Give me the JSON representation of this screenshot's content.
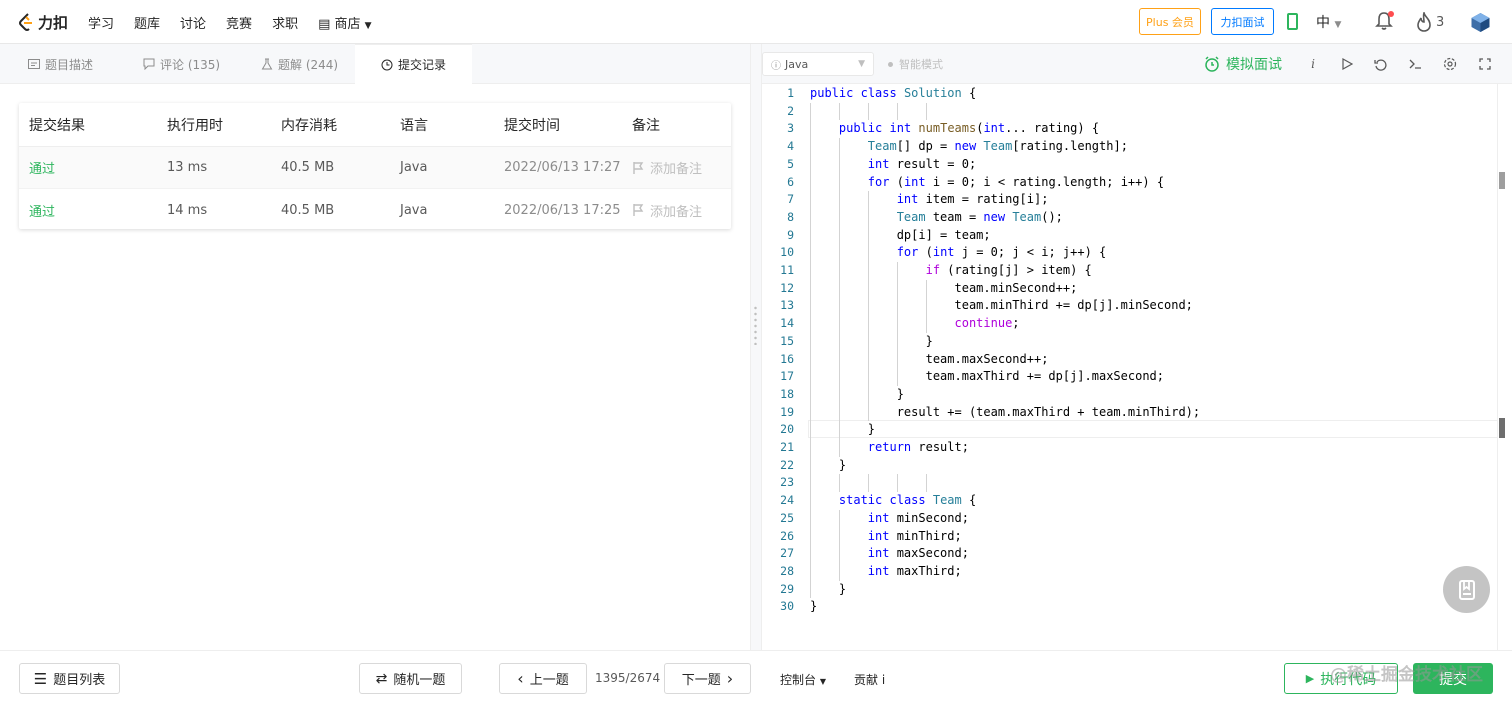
{
  "nav": {
    "logo_text": "力扣",
    "links": [
      "学习",
      "题库",
      "讨论",
      "竞赛",
      "求职"
    ],
    "store": "商店",
    "plus_label": "Plus 会员",
    "interview_label": "力扣面试",
    "lang": "中",
    "fire_count": "3"
  },
  "tabs": [
    {
      "label": "题目描述"
    },
    {
      "label": "评论 (135)"
    },
    {
      "label": "题解 (244)"
    },
    {
      "label": "提交记录"
    }
  ],
  "submissions": {
    "headers": [
      "提交结果",
      "执行用时",
      "内存消耗",
      "语言",
      "提交时间",
      "备注"
    ],
    "rows": [
      {
        "result": "通过",
        "runtime": "13 ms",
        "memory": "40.5 MB",
        "lang": "Java",
        "time": "2022/06/13 17:27",
        "note": "添加备注"
      },
      {
        "result": "通过",
        "runtime": "14 ms",
        "memory": "40.5 MB",
        "lang": "Java",
        "time": "2022/06/13 17:25",
        "note": "添加备注"
      }
    ]
  },
  "bottom_left": {
    "list_label": "题目列表",
    "random_label": "随机一题",
    "prev_label": "上一题",
    "page": "1395/2674",
    "next_label": "下一题"
  },
  "editor": {
    "language": "Java",
    "smart_mode": "智能模式",
    "mock_interview": "模拟面试",
    "lines": [
      "public class Solution {",
      "",
      "    public int numTeams(int... rating) {",
      "        Team[] dp = new Team[rating.length];",
      "        int result = 0;",
      "        for (int i = 0; i < rating.length; i++) {",
      "            int item = rating[i];",
      "            Team team = new Team();",
      "            dp[i] = team;",
      "            for (int j = 0; j < i; j++) {",
      "                if (rating[j] > item) {",
      "                    team.minSecond++;",
      "                    team.minThird += dp[j].minSecond;",
      "                    continue;",
      "                }",
      "                team.maxSecond++;",
      "                team.maxThird += dp[j].maxSecond;",
      "            }",
      "            result += (team.maxThird + team.minThird);",
      "        }",
      "        return result;",
      "    }",
      "",
      "    static class Team {",
      "        int minSecond;",
      "        int minThird;",
      "        int maxSecond;",
      "        int maxThird;",
      "    }",
      "}"
    ]
  },
  "bottom_right": {
    "console_label": "控制台",
    "contribute_label": "贡献 i",
    "run_label": "执行代码",
    "submit_label": "提交",
    "watermark": "@稀土掘金技术社区"
  }
}
